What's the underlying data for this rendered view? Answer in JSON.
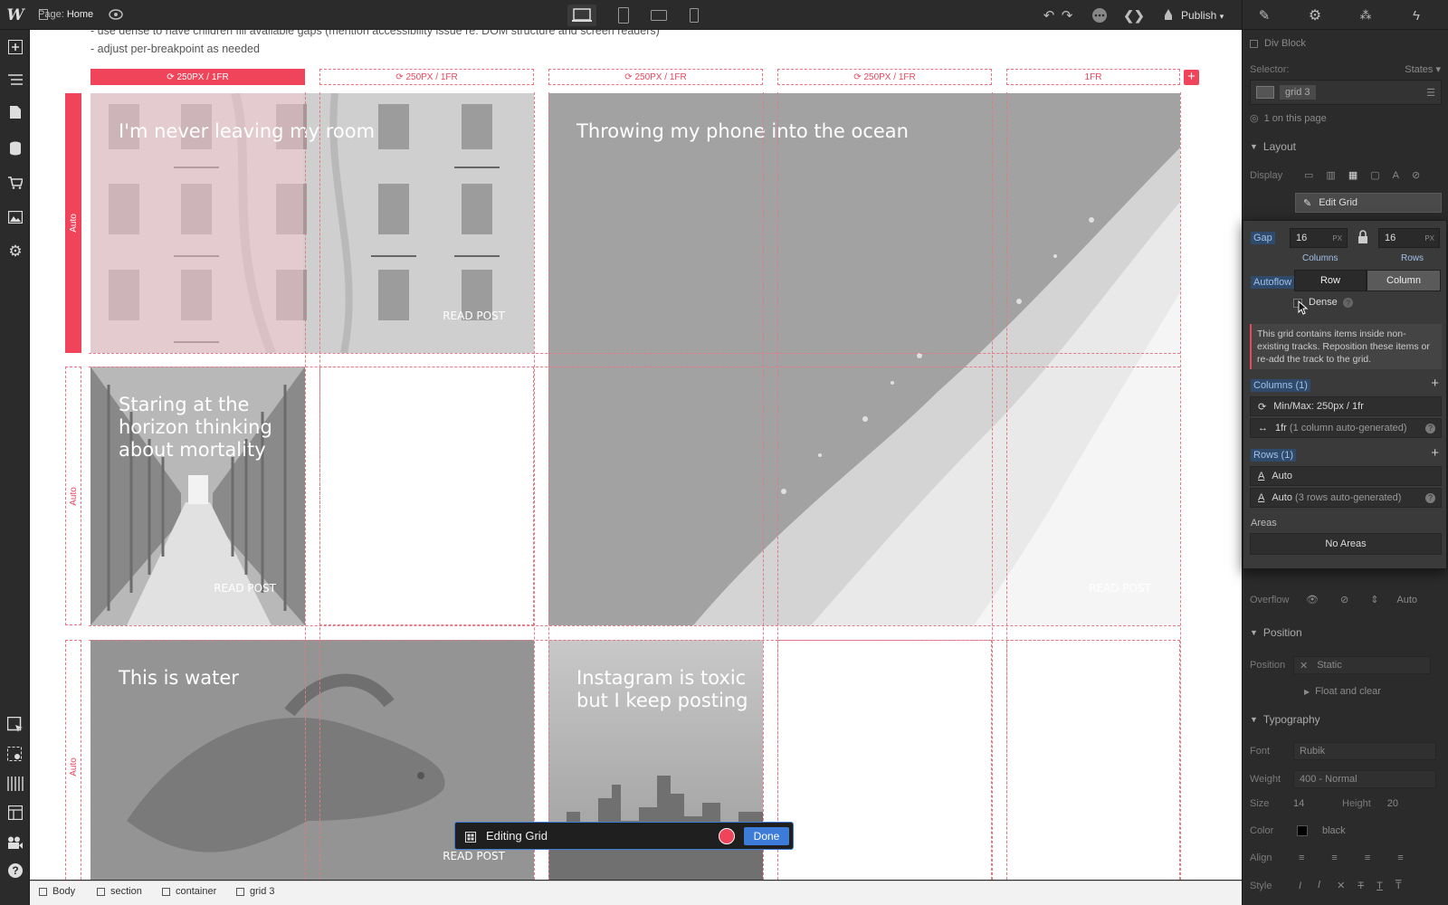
{
  "topbar": {
    "page_label": "Page:",
    "page_name": "Home",
    "publish_label": "Publish"
  },
  "canvas": {
    "notes": [
      "- use dense to have children fill available gaps (mention accessibility issue re: DOM structure and screen readers)",
      "- adjust per-breakpoint as needed"
    ],
    "columns": [
      "250PX / 1FR",
      "250PX / 1FR",
      "250PX / 1FR",
      "250PX / 1FR",
      "1FR"
    ],
    "rows": [
      "Auto",
      "Auto",
      "Auto"
    ],
    "cards": {
      "room": {
        "title": "I'm never leaving my room",
        "cta": "READ POST"
      },
      "ocean": {
        "title": "Throwing my phone into the ocean",
        "cta": "READ POST"
      },
      "horizon": {
        "title": "Staring at the horizon thinking about mortality",
        "cta": "READ POST"
      },
      "water": {
        "title": "This is water",
        "cta": "READ POST"
      },
      "instagram": {
        "title": "Instagram is toxic but I keep posting"
      }
    }
  },
  "editing_bar": {
    "label": "Editing Grid",
    "done": "Done"
  },
  "breadcrumbs": [
    "Body",
    "section",
    "container",
    "grid 3"
  ],
  "right_panel": {
    "element_type": "Div Block",
    "selector_label": "Selector:",
    "states_label": "States",
    "selector_chip": "grid 3",
    "on_page": "1 on this page",
    "layout_title": "Layout",
    "display_label": "Display",
    "edit_grid": "Edit Grid",
    "overflow_label": "Overflow",
    "overflow_auto": "Auto",
    "position_title": "Position",
    "position_label": "Position",
    "position_value": "Static",
    "float_clear": "Float and clear",
    "typography_title": "Typography",
    "font_label": "Font",
    "font_value": "Rubik",
    "weight_label": "Weight",
    "weight_value": "400 - Normal",
    "size_label": "Size",
    "size_value": "14",
    "height_label": "Height",
    "height_value": "20",
    "color_label": "Color",
    "color_value": "black",
    "align_label": "Align",
    "style_label": "Style"
  },
  "grid_popup": {
    "gap_label": "Gap",
    "gap_columns": "16",
    "gap_rows": "16",
    "unit": "PX",
    "columns_caption": "Columns",
    "rows_caption": "Rows",
    "autoflow_label": "Autoflow",
    "autoflow_row": "Row",
    "autoflow_column": "Column",
    "dense_label": "Dense",
    "warning": "This grid contains items inside non-existing tracks. Reposition these items or re-add the track to the grid.",
    "columns_header": "Columns (1)",
    "column_items": [
      {
        "main": "Min/Max: 250px / 1fr",
        "sub": ""
      },
      {
        "main": "1fr",
        "sub": "(1 column auto-generated)"
      }
    ],
    "rows_header": "Rows (1)",
    "row_items": [
      {
        "main": "Auto",
        "sub": ""
      },
      {
        "main": "Auto",
        "sub": "(3 rows auto-generated)"
      }
    ],
    "areas_label": "Areas",
    "no_areas": "No Areas"
  },
  "colors": {
    "accent": "#f0445a",
    "panel": "#2b2b2b",
    "blue": "#3d7bd9"
  }
}
